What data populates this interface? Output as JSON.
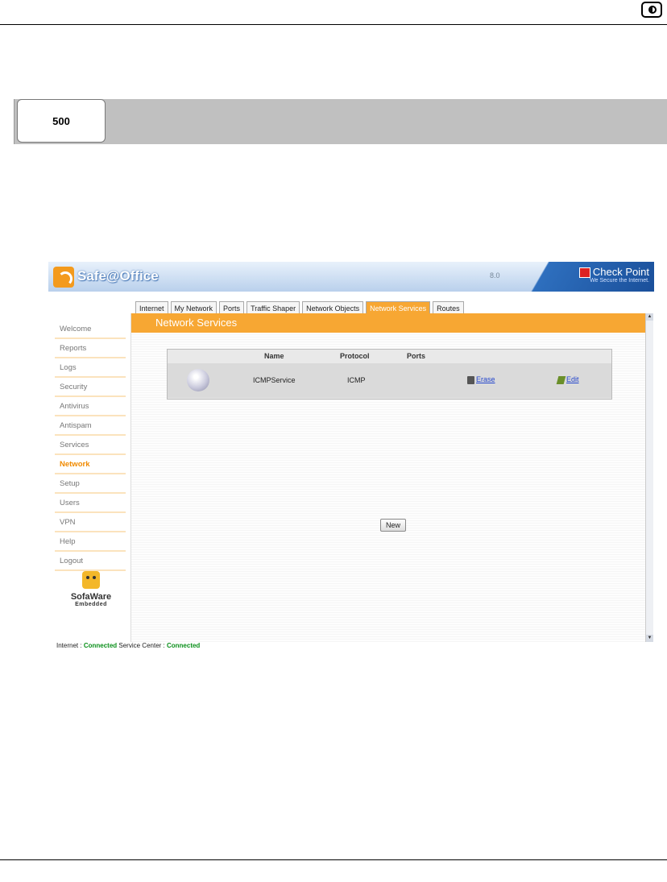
{
  "doc": {
    "tab_label": "500"
  },
  "app": {
    "logo_text": "Safe@Office",
    "version": "8.0",
    "brand": "Check Point",
    "brand_tagline": "We Secure the Internet.",
    "tabs": [
      {
        "label": "Internet",
        "active": false
      },
      {
        "label": "My Network",
        "active": false
      },
      {
        "label": "Ports",
        "active": false
      },
      {
        "label": "Traffic Shaper",
        "active": false
      },
      {
        "label": "Network Objects",
        "active": false
      },
      {
        "label": "Network Services",
        "active": true
      },
      {
        "label": "Routes",
        "active": false
      }
    ],
    "sidebar": [
      {
        "label": "Welcome",
        "active": false
      },
      {
        "label": "Reports",
        "active": false
      },
      {
        "label": "Logs",
        "active": false
      },
      {
        "label": "Security",
        "active": false
      },
      {
        "label": "Antivirus",
        "active": false
      },
      {
        "label": "Antispam",
        "active": false
      },
      {
        "label": "Services",
        "active": false
      },
      {
        "label": "Network",
        "active": true
      },
      {
        "label": "Setup",
        "active": false
      },
      {
        "label": "Users",
        "active": false
      },
      {
        "label": "VPN",
        "active": false
      },
      {
        "label": "Help",
        "active": false
      },
      {
        "label": "Logout",
        "active": false
      }
    ],
    "sofaware": {
      "name": "SofaWare",
      "sub": "Embedded"
    },
    "page_title": "Network Services",
    "table": {
      "headers": {
        "name": "Name",
        "protocol": "Protocol",
        "ports": "Ports"
      },
      "rows": [
        {
          "name": "ICMPService",
          "protocol": "ICMP",
          "ports": "",
          "erase": "Erase",
          "edit": "Edit"
        }
      ]
    },
    "new_button": "New",
    "status": {
      "internet_label": "Internet :",
      "internet_value": "Connected",
      "service_label": "Service Center :",
      "service_value": "Connected"
    },
    "colors": {
      "accent": "#f7a733",
      "status_ok": "#0a8f1a",
      "link": "#2244cc"
    }
  }
}
